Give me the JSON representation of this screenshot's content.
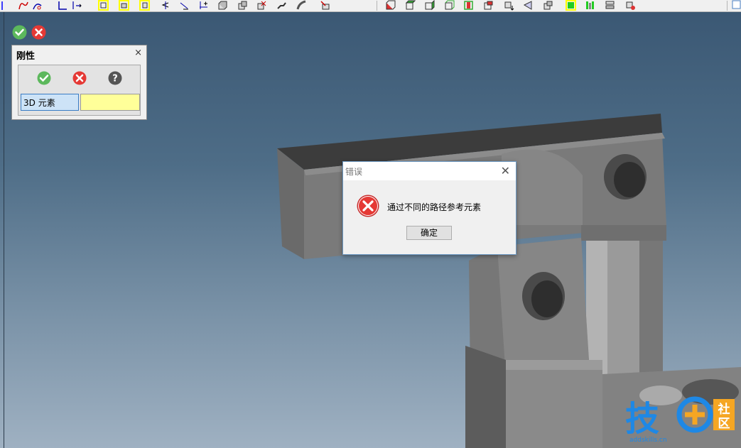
{
  "toolbar": {
    "left_icons": [
      "curve-icon",
      "sketch-path-icon",
      "snap-corner-icon",
      "frame-icon",
      "box-select-icon",
      "box-select-alt-icon",
      "arrow-left-icon",
      "arrow-point-icon",
      "grid-add-icon",
      "solid-a-icon",
      "solid-b-icon",
      "solid-c-icon",
      "solid-d-icon",
      "curve-solid-icon",
      "curve-sweep-icon",
      "shape-red-icon"
    ],
    "right_icons": [
      "red-cube-icon",
      "green-cube-icon",
      "green-cube-alt-icon",
      "cube-outline-icon",
      "red-plane-icon",
      "cube-highlight-icon",
      "cube-arrow-icon",
      "cone-icon",
      "cube-split-icon",
      "green-square-icon",
      "green-bars-icon",
      "stack-icon",
      "cube-red-mark-icon"
    ]
  },
  "viewport_actions": {
    "confirm_label": "✔",
    "cancel_label": "✖"
  },
  "panel": {
    "title": "刚性",
    "close": "×",
    "field_label": "3D 元素",
    "field_value": ""
  },
  "dialog": {
    "title": "错误",
    "close": "✕",
    "message": "通过不同的路径参考元素",
    "ok_label": "确定"
  },
  "watermark": {
    "brand_char": "技",
    "badge_top": "社",
    "badge_bottom": "区",
    "url": "addskills.cn"
  },
  "colors": {
    "confirm": "#5cb85c",
    "cancel": "#e53935",
    "help": "#555555",
    "field_highlight": "#ffff99",
    "watermark_blue": "#1e88e5",
    "watermark_orange": "#f5a623"
  }
}
